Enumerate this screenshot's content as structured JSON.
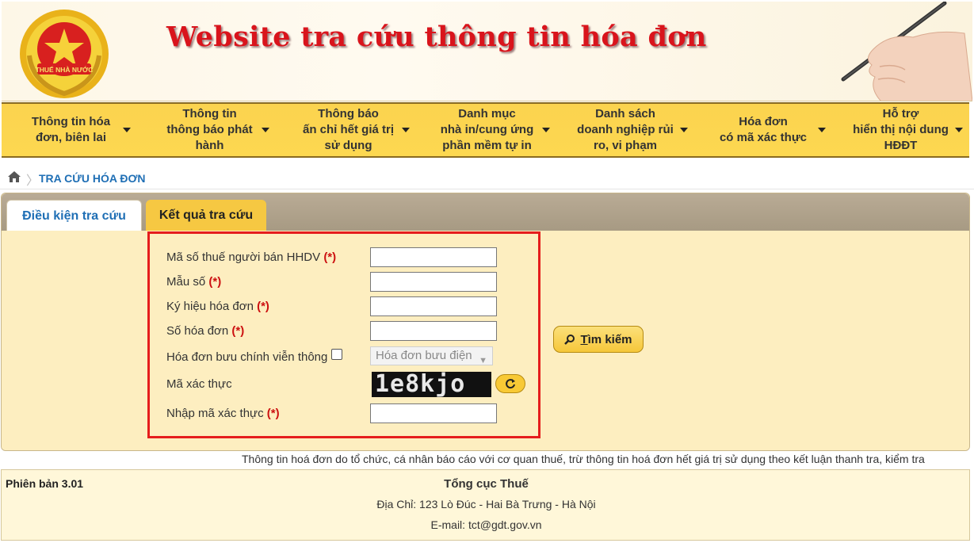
{
  "banner": {
    "title": "Website tra cứu thông tin hóa đơn",
    "emblem_text": "THUẾ NHÀ NƯỚC"
  },
  "nav": {
    "items": [
      {
        "label": "Thông tin hóa\nđơn, biên lai"
      },
      {
        "label": "Thông tin\nthông báo phát\nhành"
      },
      {
        "label": "Thông báo\nấn chỉ hết giá trị\nsử dụng"
      },
      {
        "label": "Danh mục\nnhà in/cung ứng\nphần mềm tự in"
      },
      {
        "label": "Danh sách\ndoanh nghiệp rủi\nro, vi phạm"
      },
      {
        "label": "Hóa đơn\ncó mã xác thực"
      },
      {
        "label": "Hỗ trợ\nhiển thị nội dung\nHĐĐT"
      }
    ]
  },
  "breadcrumb": {
    "current": "TRA CỨU HÓA ĐƠN"
  },
  "tabs": {
    "active": "Điều kiện tra cứu",
    "inactive": "Kết quả tra cứu"
  },
  "form": {
    "required_mark": "(*)",
    "seller_tax_code": "Mã số thuế người bán HHDV",
    "template": "Mẫu số",
    "symbol": "Ký hiệu hóa đơn",
    "number": "Số hóa đơn",
    "postal_invoice": "Hóa đơn bưu chính viễn thông",
    "postal_select": "Hóa đơn bưu điện",
    "captcha_label": "Mã xác thực",
    "captcha_value": "1e8kjo",
    "captcha_input": "Nhập mã xác thực",
    "search_key": "T",
    "search_rest": "ìm kiếm"
  },
  "notice": "Thông tin hoá đơn do tổ chức, cá nhân báo cáo với cơ quan thuế, trừ thông tin hoá đơn hết giá trị sử dụng theo kết luận thanh tra, kiểm tra",
  "footer": {
    "version": "Phiên bản 3.01",
    "org": "Tổng cục Thuế",
    "address": "Địa Chỉ: 123 Lò Đúc - Hai Bà Trưng - Hà Nội",
    "email": "E-mail: tct@gdt.gov.vn"
  },
  "colors": {
    "accent_red": "#d9141c",
    "nav_yellow": "#fbd34f",
    "link_blue": "#1f6fb5"
  }
}
